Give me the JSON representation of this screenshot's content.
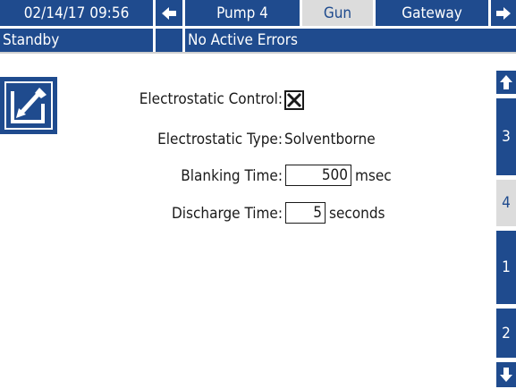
{
  "header": {
    "datetime": "02/14/17 09:56",
    "tabs": [
      {
        "label": "Pump 4",
        "active": false
      },
      {
        "label": "Gun",
        "active": true
      },
      {
        "label": "Gateway",
        "active": false
      }
    ]
  },
  "status": {
    "mode": "Standby",
    "errors": "No Active Errors"
  },
  "form": {
    "electrostatic_control": {
      "label": "Electrostatic Control:",
      "checked": true
    },
    "electrostatic_type": {
      "label": "Electrostatic Type:",
      "value": "Solventborne"
    },
    "blanking_time": {
      "label": "Blanking Time:",
      "value": "500",
      "unit": "msec"
    },
    "discharge_time": {
      "label": "Discharge Time:",
      "value": "5",
      "unit": "seconds"
    }
  },
  "sidebar": {
    "pages": [
      {
        "label": "3",
        "active": false
      },
      {
        "label": "4",
        "active": true
      },
      {
        "label": "1",
        "active": false
      },
      {
        "label": "2",
        "active": false
      }
    ]
  },
  "icons": {
    "edit": "edit-icon",
    "left": "arrow-left-icon",
    "right": "arrow-right-icon",
    "up": "arrow-up-icon",
    "down": "arrow-down-icon"
  },
  "colors": {
    "primary": "#1f4b8e",
    "inactive": "#dcdcdc",
    "background": "#ffffff"
  }
}
